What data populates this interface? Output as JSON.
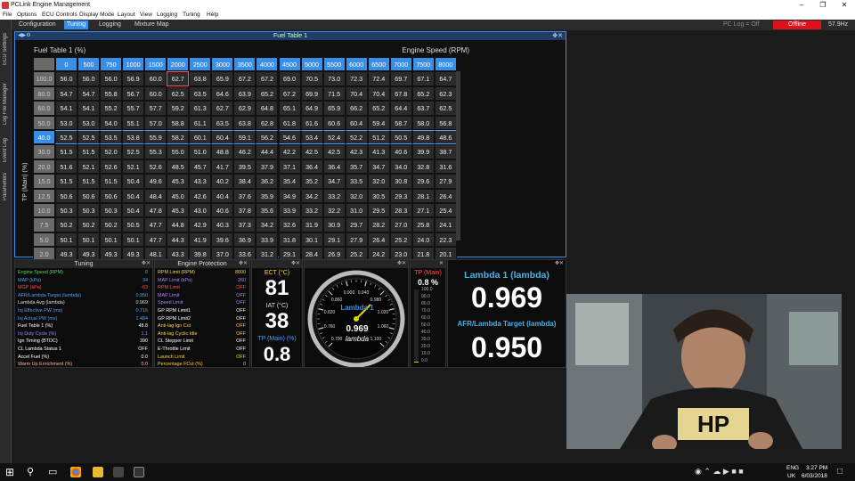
{
  "window": {
    "title": "PCLink Engine Management",
    "minimize": "–",
    "maximize": "❐",
    "close": "✕"
  },
  "menu": [
    "File",
    "Options",
    "ECU Controls",
    "Display Mode",
    "Layout",
    "View",
    "Logging",
    "Tuning",
    "Help"
  ],
  "tabs": [
    {
      "label": "Configuration",
      "active": false
    },
    {
      "label": "Tuning",
      "active": true
    },
    {
      "label": "Logging",
      "active": false
    },
    {
      "label": "Mixture Map",
      "active": false
    }
  ],
  "status": {
    "pc_log": "PC Log = Off",
    "connection": "Offline",
    "fps": "57.9Hz"
  },
  "sidebar": [
    "ECU Settings",
    "Log File Manager",
    "Event Log",
    "Parameters"
  ],
  "fuel_table": {
    "window_title": "Fuel Table 1",
    "table_label": "Fuel Table 1 (%)",
    "x_axis_label": "Engine Speed (RPM)",
    "y_axis_label": "TP (Main) (%)",
    "rpm": [
      "0",
      "500",
      "750",
      "1000",
      "1500",
      "2000",
      "2500",
      "3000",
      "3500",
      "4000",
      "4500",
      "5000",
      "5500",
      "6000",
      "6500",
      "7000",
      "7500",
      "8000"
    ],
    "rows": [
      {
        "tp": "100.0",
        "values": [
          "56.0",
          "56.0",
          "56.0",
          "56.9",
          "60.0",
          "62.7",
          "63.8",
          "65.9",
          "67.2",
          "67.2",
          "69.0",
          "70.5",
          "73.0",
          "72.3",
          "72.4",
          "69.7",
          "67.1",
          "64.7"
        ]
      },
      {
        "tp": "80.0",
        "values": [
          "54.7",
          "54.7",
          "55.8",
          "56.7",
          "60.0",
          "62.5",
          "63.5",
          "64.6",
          "63.9",
          "65.2",
          "67.2",
          "69.9",
          "71.5",
          "70.4",
          "70.4",
          "67.8",
          "65.2",
          "62.3"
        ]
      },
      {
        "tp": "60.0",
        "values": [
          "54.1",
          "54.1",
          "55.2",
          "55.7",
          "57.7",
          "59.2",
          "61.3",
          "62.7",
          "62.9",
          "64.8",
          "65.1",
          "64.9",
          "65.9",
          "66.2",
          "65.2",
          "64.4",
          "63.7",
          "62.5"
        ]
      },
      {
        "tp": "50.0",
        "values": [
          "53.0",
          "53.0",
          "54.0",
          "55.1",
          "57.0",
          "58.8",
          "61.1",
          "63.5",
          "63.8",
          "62.8",
          "61.8",
          "61.6",
          "60.6",
          "60.4",
          "59.4",
          "58.7",
          "58.0",
          "56.8"
        ]
      },
      {
        "tp": "40.0",
        "values": [
          "52.5",
          "52.5",
          "53.5",
          "53.8",
          "55.9",
          "58.2",
          "60.1",
          "60.4",
          "59.1",
          "56.2",
          "54.6",
          "53.4",
          "52.4",
          "52.2",
          "51.2",
          "50.5",
          "49.8",
          "48.6"
        ]
      },
      {
        "tp": "30.0",
        "values": [
          "51.5",
          "51.5",
          "52.0",
          "52.5",
          "55.3",
          "55.0",
          "51.0",
          "48.8",
          "46.2",
          "44.4",
          "42.2",
          "42.5",
          "42.5",
          "42.3",
          "41.3",
          "40.6",
          "39.9",
          "38.7"
        ]
      },
      {
        "tp": "20.0",
        "values": [
          "51.6",
          "52.1",
          "52.6",
          "52.1",
          "52.6",
          "48.5",
          "45.7",
          "41.7",
          "39.5",
          "37.9",
          "37.1",
          "36.4",
          "36.4",
          "35.7",
          "34.7",
          "34.0",
          "32.8",
          "31.6"
        ]
      },
      {
        "tp": "15.0",
        "values": [
          "51.5",
          "51.5",
          "51.5",
          "50.4",
          "49.6",
          "45.3",
          "43.3",
          "40.2",
          "38.4",
          "36.2",
          "35.4",
          "35.2",
          "34.7",
          "33.5",
          "32.0",
          "30.8",
          "29.6",
          "27.9"
        ]
      },
      {
        "tp": "12.5",
        "values": [
          "50.6",
          "50.6",
          "50.6",
          "50.4",
          "48.4",
          "45.0",
          "42.6",
          "40.4",
          "37.6",
          "35.9",
          "34.9",
          "34.2",
          "33.2",
          "32.0",
          "30.5",
          "29.3",
          "28.1",
          "26.4"
        ]
      },
      {
        "tp": "10.0",
        "values": [
          "50.3",
          "50.3",
          "50.3",
          "50.4",
          "47.8",
          "45.3",
          "43.0",
          "40.6",
          "37.8",
          "35.6",
          "33.9",
          "33.2",
          "32.2",
          "31.0",
          "29.5",
          "28.3",
          "27.1",
          "25.4"
        ]
      },
      {
        "tp": "7.5",
        "values": [
          "50.2",
          "50.2",
          "50.2",
          "50.5",
          "47.7",
          "44.8",
          "42.9",
          "40.3",
          "37.3",
          "34.2",
          "32.6",
          "31.9",
          "30.9",
          "29.7",
          "28.2",
          "27.0",
          "25.8",
          "24.1"
        ]
      },
      {
        "tp": "5.0",
        "values": [
          "50.1",
          "50.1",
          "50.1",
          "50.1",
          "47.7",
          "44.3",
          "41.9",
          "39.6",
          "36.9",
          "33.9",
          "31.8",
          "30.1",
          "29.1",
          "27.9",
          "26.4",
          "25.2",
          "24.0",
          "22.3"
        ]
      },
      {
        "tp": "2.0",
        "values": [
          "49.3",
          "49.3",
          "49.3",
          "49.3",
          "48.1",
          "43.3",
          "39.8",
          "37.0",
          "33.6",
          "31.2",
          "29.1",
          "28.4",
          "26.9",
          "25.2",
          "24.2",
          "23.0",
          "21.8",
          "20.1"
        ]
      }
    ]
  },
  "tuning_panel": {
    "title": "Tuning",
    "rows": [
      {
        "label": "Engine Speed (RPM)",
        "value": "0",
        "color": "#5ad05a"
      },
      {
        "label": "MAP (kPa)",
        "value": "34",
        "color": "#4aa0ff"
      },
      {
        "label": "MGP (kPa)",
        "value": "-63",
        "color": "#ff5050"
      },
      {
        "label": "AFR/Lambda Target (lambda)",
        "value": "0.950",
        "color": "#4aa0ff"
      },
      {
        "label": "Lambda Avg (lambda)",
        "value": "0.969",
        "color": "#dddddd"
      },
      {
        "label": "Inj Effective PW (ms)",
        "value": "0.715",
        "color": "#4aa0ff"
      },
      {
        "label": "Inj Actual PW (ms)",
        "value": "1.484",
        "color": "#4aa0ff"
      },
      {
        "label": "Fuel Table 1 (%)",
        "value": "48.8",
        "color": "#ffffff"
      },
      {
        "label": "Inj Duty Cycle (%)",
        "value": "1.1",
        "color": "#b080ff"
      },
      {
        "label": "Ign Timing (BTDC)",
        "value": "390",
        "color": "#ffffff"
      },
      {
        "label": "CL Lambda Status 1",
        "value": "OFF",
        "color": "#ffffff"
      },
      {
        "label": "Accel Fuel (%)",
        "value": "0.0",
        "color": "#ffffff"
      },
      {
        "label": "Warm Up Enrichment (%)",
        "value": "0.0",
        "color": "#ffb0b0"
      }
    ]
  },
  "protection_panel": {
    "title": "Engine Protection",
    "rows": [
      {
        "label": "RPM Limit (RPM)",
        "value": "8000",
        "color": "#ffd040"
      },
      {
        "label": "MAP Limit (kPa)",
        "value": "260",
        "color": "#b080ff"
      },
      {
        "label": "RPM Limit",
        "value": "OFF",
        "color": "#ff5050"
      },
      {
        "label": "MAP Limit",
        "value": "OFF",
        "color": "#b080ff"
      },
      {
        "label": "Speed Limit",
        "value": "OFF",
        "color": "#b080ff"
      },
      {
        "label": "GP RPM Limit1",
        "value": "OFF",
        "color": "#ffffff"
      },
      {
        "label": "GP RPM Limit2",
        "value": "OFF",
        "color": "#ffffff"
      },
      {
        "label": "Anti-lag Ign Cut",
        "value": "OFF",
        "color": "#ffd040"
      },
      {
        "label": "Anti-lag Cyclic Idle",
        "value": "OFF",
        "color": "#ffd040"
      },
      {
        "label": "CL Stepper Limit",
        "value": "OFF",
        "color": "#ffffff"
      },
      {
        "label": "E-Throttle Limit",
        "value": "OFF",
        "color": "#ffffff"
      },
      {
        "label": "Launch Limit",
        "value": "OFF",
        "color": "#ffd040"
      },
      {
        "label": "Percentage FCut (%)",
        "value": "0",
        "color": "#ffd040"
      }
    ]
  },
  "gauges": {
    "ect_label": "ECT (°C)",
    "ect_value": "81",
    "iat_label": "IAT (°C)",
    "iat_value": "38",
    "tp_label": "TP (Main) (%)",
    "tp_value": "0.8",
    "lambda_dial": {
      "label": "Lambda 1",
      "value": "0.969",
      "unit": "lambda",
      "ticks": [
        "0.700",
        "0.760",
        "0.820",
        "0.860",
        "0.900",
        "0.940",
        "0.980",
        "1.020",
        "1.060",
        "1.100"
      ]
    },
    "tp_bar": {
      "label": "TP (Main)",
      "value": "0.8 %",
      "ticks": [
        "100.0",
        "90.0",
        "80.0",
        "70.0",
        "60.0",
        "50.0",
        "40.0",
        "30.0",
        "20.0",
        "10.0",
        "0.0"
      ]
    },
    "lambda1_label": "Lambda 1 (lambda)",
    "lambda1_value": "0.969",
    "target_label": "AFR/Lambda Target (lambda)",
    "target_value": "0.950"
  },
  "taskbar": {
    "lang": "ENG",
    "region": "UK",
    "time": "3:27 PM",
    "date": "6/03/2018"
  }
}
